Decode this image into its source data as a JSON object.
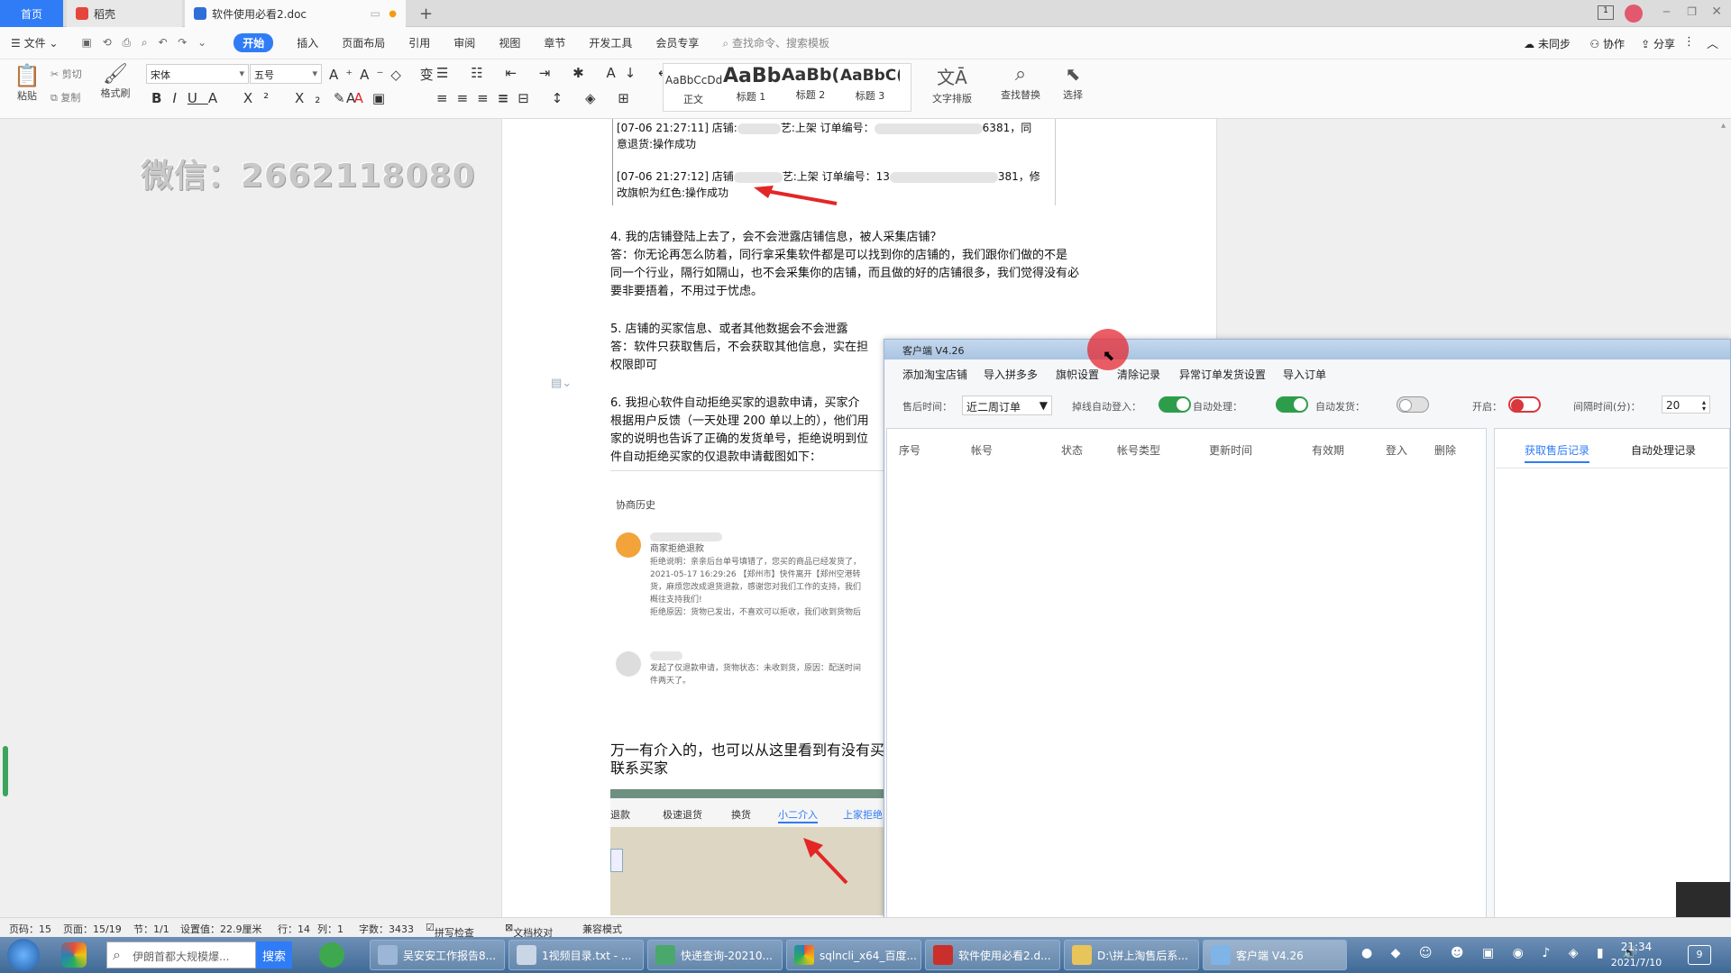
{
  "tabs": {
    "home": "首页",
    "daoke": "稻壳",
    "doc": "软件使用必看2.doc"
  },
  "menu": {
    "file": "文件",
    "items": [
      "开始",
      "插入",
      "页面布局",
      "引用",
      "审阅",
      "视图",
      "章节",
      "开发工具",
      "会员专享"
    ],
    "search": "查找命令、搜索模板",
    "right": [
      "未同步",
      "协作",
      "分享"
    ]
  },
  "ribbon": {
    "paste": "粘贴",
    "cut": "剪切",
    "copy": "复制",
    "format_painter": "格式刷",
    "font": "宋体",
    "size": "五号",
    "styles": [
      {
        "sample": "AaBbCcDd",
        "name": "正文"
      },
      {
        "sample": "AaBb",
        "name": "标题 1"
      },
      {
        "sample": "AaBb(",
        "name": "标题 2"
      },
      {
        "sample": "AaBbC(",
        "name": "标题 3"
      }
    ],
    "text_layout": "文字排版",
    "find_replace": "查找替换",
    "select": "选择"
  },
  "watermark": "微信：2662118080",
  "doc": {
    "log1a": "[07-06 21:27:11] 店铺:",
    "log1b": "艺:上架 订单编号：",
    "log1c": "6381，同",
    "log1d": "意退货:操作成功",
    "log2a": "[07-06 21:27:12] 店铺",
    "log2b": "艺:上架 订单编号：13",
    "log2c": "381，修",
    "log2d": "改旗帜为红色:操作成功",
    "q4": "4.  我的店铺登陆上去了，会不会泄露店铺信息，被人采集店铺？",
    "a4_1": "   答：你无论再怎么防着，同行拿采集软件都是可以找到你的店铺的，我们跟你们做的不是",
    "a4_2": "同一个行业，隔行如隔山，也不会采集你的店铺，而且做的好的店铺很多，我们觉得没有必",
    "a4_3": "要非要捂着，不用过于忧虑。",
    "q5": "5.  店铺的买家信息、或者其他数据会不会泄露",
    "a5_1": "答：软件只获取售后，不会获取其他信息，实在担",
    "a5_2": "权限即可",
    "q6_1": "6.  我担心软件自动拒绝买家的退款申请，买家介",
    "q6_2": "根据用户反馈（一天处理 200 单以上的），他们用",
    "q6_3": "家的说明也告诉了正确的发货单号，拒绝说明到位",
    "q6_4": "件自动拒绝买家的仅退款申请截图如下：",
    "history_title": "协商历史",
    "h1": "商家拒绝退款",
    "h2": "拒绝说明：亲亲后台单号填错了，您买的商品已经发货了，",
    "h3": "2021-05-17 16:29:26 【郑州市】快件离开【郑州空港转",
    "h4": "货，麻烦您改成退货退款，感谢您对我们工作的支持，我们",
    "h5": "概往支持我们!",
    "h6": "拒绝原因：货物已发出，不喜欢可以拒收，我们收到货物后",
    "h7": "发起了仅退款申请，货物状态：未收到货，原因：配送时间",
    "h8": "件两天了。",
    "p_large1": "万一有介入的，也可以从这里看到有没有买",
    "p_large2": "联系买家",
    "strip": [
      "退款",
      "极速退货",
      "换货",
      "小二介入",
      "上家拒绝"
    ]
  },
  "status": {
    "page_code": "页码：15",
    "page": "页面：15/19",
    "section": "节：1/1",
    "setting": "设置值：22.9厘米",
    "row": "行：14",
    "col": "列：1",
    "words": "字数：3433",
    "spell": "拼写检查",
    "proof": "文档校对",
    "compat": "兼容模式"
  },
  "client": {
    "title": "客户端 V4.26",
    "menu": [
      "添加淘宝店铺",
      "导入拼多多",
      "旗帜设置",
      "清除记录",
      "异常订单发货设置",
      "导入订单"
    ],
    "after_time_label": "售后时间：",
    "after_time_value": "近二周订单",
    "auto_login": "掉线自动登入：",
    "auto_process": "自动处理：",
    "auto_ship": "自动发货：",
    "enable": "开启：",
    "interval_label": "间隔时间(分)：",
    "interval_value": "20",
    "columns": [
      "序号",
      "帐号",
      "状态",
      "帐号类型",
      "更新时间",
      "有效期",
      "登入",
      "删除"
    ],
    "tabs": [
      "获取售后记录",
      "自动处理记录"
    ],
    "toggle_on": "#2e9d4b",
    "toggle_red": "#d9363e"
  },
  "taskbar": {
    "search_placeholder": "伊朗首都大规模爆...",
    "search_btn": "搜索",
    "items": [
      "吴安安工作报告8...",
      "1视频目录.txt - ...",
      "快递查询-20210...",
      "sqlncli_x64_百度...",
      "软件使用必看2.d...",
      "D:\\拼上淘售后系...",
      "客户端 V4.26"
    ],
    "time": "21:34",
    "date": "2021/7/10"
  }
}
